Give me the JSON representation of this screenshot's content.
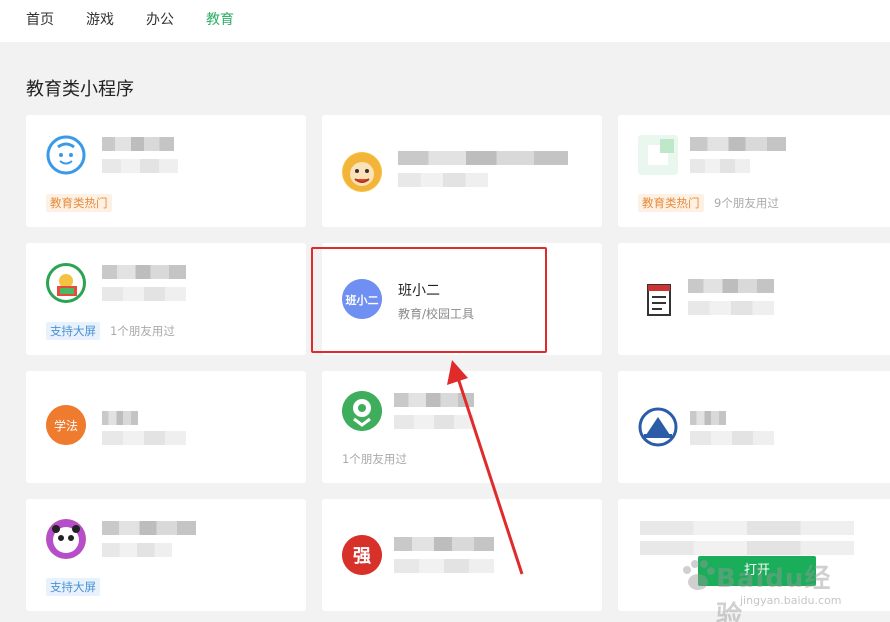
{
  "nav": {
    "items": [
      "首页",
      "游戏",
      "办公",
      "教育"
    ],
    "active_index": 3
  },
  "section": {
    "title": "教育类小程序"
  },
  "cards": {
    "c1": {
      "tag": "教育类热门"
    },
    "c3": {
      "tag": "教育类热门",
      "friends": "9个朋友用过"
    },
    "c4": {
      "tag": "支持大屏",
      "friends": "1个朋友用过"
    },
    "c5": {
      "name": "班小二",
      "category": "教育/校园工具",
      "icon_text": "班小二"
    },
    "c7": {
      "icon_text": "学法"
    },
    "c8": {
      "friends": "1个朋友用过"
    },
    "c10": {
      "tag": "支持大屏"
    },
    "c11": {
      "icon_text": "强"
    },
    "c12": {
      "button": "打开"
    }
  },
  "watermark": {
    "text": "Baidu经验",
    "sub": "jingyan.baidu.com"
  },
  "colors": {
    "accent_green": "#2aae67",
    "highlight_red": "#e02b2b",
    "hot_tag": "#e68a3b",
    "bigscreen_tag": "#4a8fd6",
    "open_button": "#1aad5a"
  }
}
